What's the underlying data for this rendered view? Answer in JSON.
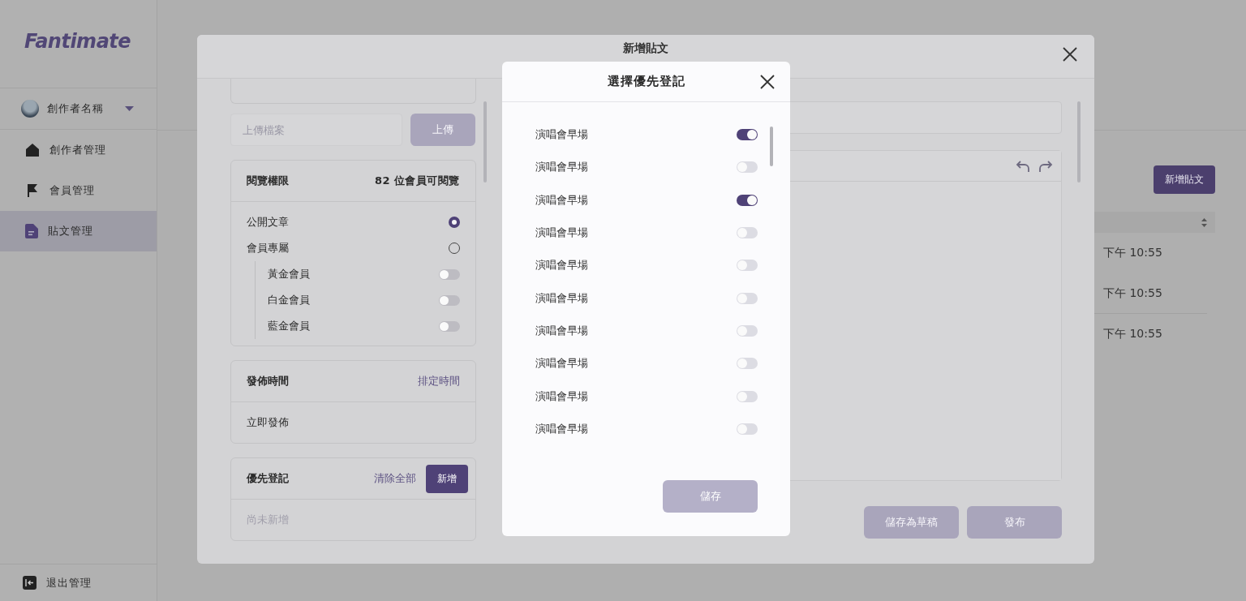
{
  "sidebar": {
    "logo": "Fantimate",
    "user": {
      "name": "創作者名稱"
    },
    "items": [
      {
        "label": "創作者管理",
        "kind": "house",
        "selected": false
      },
      {
        "label": "會員管理",
        "kind": "flag",
        "selected": false
      },
      {
        "label": "貼文管理",
        "kind": "document",
        "selected": true
      }
    ],
    "logout": "退出管理"
  },
  "page": {
    "new_post_button": "新增貼文",
    "rows": [
      {
        "time": "下午 10:55"
      },
      {
        "time": "下午 10:55"
      },
      {
        "time": "下午 10:55"
      }
    ]
  },
  "post_modal": {
    "title": "新增貼文",
    "upload": {
      "placeholder": "上傳檔案",
      "button": "上傳",
      "disabled": true
    },
    "permissions": {
      "title": "閱覽權限",
      "count": "82 位會員可閱覽",
      "options": [
        {
          "label": "公開文章",
          "selected": true
        },
        {
          "label": "會員專屬",
          "selected": false
        }
      ],
      "tiers": [
        {
          "label": "黃金會員",
          "on": false
        },
        {
          "label": "白金會員",
          "on": false
        },
        {
          "label": "藍金會員",
          "on": false
        }
      ]
    },
    "publish_time": {
      "title": "發佈時間",
      "link": "排定時間",
      "value": "立即發佈"
    },
    "priority": {
      "title": "優先登記",
      "clear": "清除全部",
      "add": "新增",
      "empty": "尚未新增"
    },
    "buttons": [
      {
        "label": "儲存為草稿",
        "disabled": true
      },
      {
        "label": "發布",
        "disabled": true
      }
    ]
  },
  "priority_modal": {
    "title": "選擇優先登記",
    "items": [
      {
        "label": "演唱會早場",
        "on": true
      },
      {
        "label": "演唱會早場",
        "on": false
      },
      {
        "label": "演唱會早場",
        "on": true
      },
      {
        "label": "演唱會早場",
        "on": false
      },
      {
        "label": "演唱會早場",
        "on": false
      },
      {
        "label": "演唱會早場",
        "on": false
      },
      {
        "label": "演唱會早場",
        "on": false
      },
      {
        "label": "演唱會早場",
        "on": false
      },
      {
        "label": "演唱會早場",
        "on": false
      },
      {
        "label": "演唱會早場",
        "on": false
      }
    ],
    "save": {
      "label": "儲存",
      "disabled": true
    }
  }
}
